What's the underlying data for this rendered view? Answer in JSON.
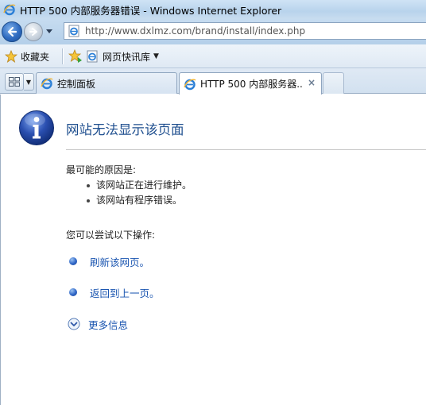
{
  "window": {
    "title": "HTTP 500 内部服务器错误 - Windows Internet Explorer"
  },
  "address": {
    "url": "http://www.dxlmz.com/brand/install/index.php"
  },
  "favorites_bar": {
    "favorites_label": "收藏夹",
    "web_slice_label": "网页快讯库"
  },
  "tabs": [
    {
      "label": "控制面板",
      "active": false
    },
    {
      "label": "HTTP 500 内部服务器...",
      "active": true
    }
  ],
  "page": {
    "title": "网站无法显示该页面",
    "reasons_heading": "最可能的原因是:",
    "reasons": [
      "该网站正在进行维护。",
      "该网站有程序错误。"
    ],
    "actions_heading": "您可以尝试以下操作:",
    "actions": [
      {
        "label": "刷新该网页。"
      },
      {
        "label": "返回到上一页。"
      }
    ],
    "more_info_label": "更多信息"
  },
  "colors": {
    "title_text": "#1f4f8f",
    "link_text": "#1a55b0",
    "info_icon": "#2a4fb0"
  },
  "icons": {
    "app": "ie-logo-icon",
    "back": "back-arrow-icon",
    "forward": "forward-arrow-icon",
    "favorites": "star-icon",
    "add_favorite": "add-favorite-star-icon",
    "web_slice": "ie-page-icon",
    "quick_tabs": "quick-tabs-grid-icon",
    "info": "info-icon",
    "more_info": "expand-chevron-icon"
  }
}
